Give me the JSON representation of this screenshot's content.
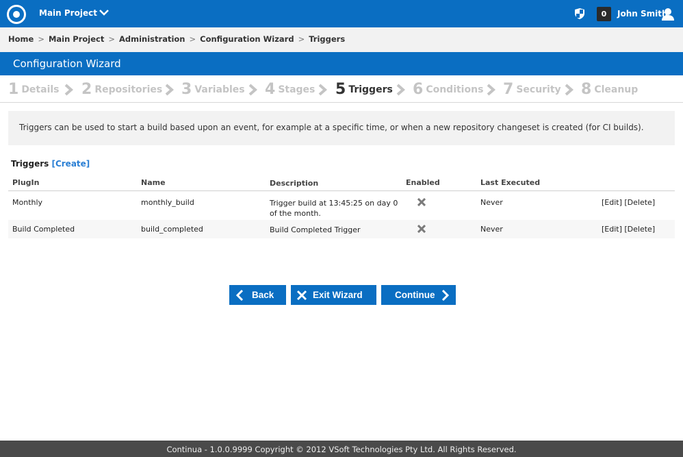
{
  "header": {
    "project": "Main Project",
    "badge_count": "0",
    "user": "John Smith"
  },
  "breadcrumb": [
    "Home",
    "Main Project",
    "Administration",
    "Configuration Wizard",
    "Triggers"
  ],
  "wizard": {
    "title": "Configuration Wizard",
    "steps": [
      {
        "num": "1",
        "label": "Details"
      },
      {
        "num": "2",
        "label": "Repositories"
      },
      {
        "num": "3",
        "label": "Variables"
      },
      {
        "num": "4",
        "label": "Stages"
      },
      {
        "num": "5",
        "label": "Triggers"
      },
      {
        "num": "6",
        "label": "Conditions"
      },
      {
        "num": "7",
        "label": "Security"
      },
      {
        "num": "8",
        "label": "Cleanup"
      }
    ],
    "active_step": 5
  },
  "info": "Triggers can be used to start a build based upon an event, for example at a specific time, or when a new repository changeset is created (for CI builds).",
  "triggers": {
    "title": "Triggers",
    "create_label": "[Create]",
    "columns": [
      "PlugIn",
      "Name",
      "Description",
      "Enabled",
      "Last Executed"
    ],
    "rows": [
      {
        "plugin": "Monthly",
        "name": "monthly_build",
        "description": "Trigger build at 13:45:25 on day 0 of the month.",
        "last_executed": "Never",
        "edit": "[Edit]",
        "delete": "[Delete]"
      },
      {
        "plugin": "Build Completed",
        "name": "build_completed",
        "description": "Build Completed Trigger",
        "last_executed": "Never",
        "edit": "[Edit]",
        "delete": "[Delete]"
      }
    ]
  },
  "buttons": {
    "back": "Back",
    "exit": "Exit Wizard",
    "continue": "Continue"
  },
  "footer": "Continua - 1.0.0.9999 Copyright © 2012 VSoft Technologies Pty Ltd. All Rights Reserved.",
  "colors": {
    "brand": "#0a6ec2",
    "link": "#2a7fd4"
  }
}
